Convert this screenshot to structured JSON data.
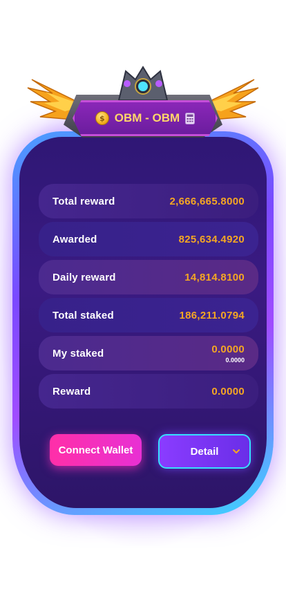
{
  "header": {
    "title": "OBM - OBM",
    "icons": [
      "coin-icon",
      "calculator-icon",
      "gem-crest-icon",
      "wing-left-icon",
      "wing-right-icon"
    ]
  },
  "stats": [
    {
      "label": "Total reward",
      "value": "2,666,665.8000"
    },
    {
      "label": "Awarded",
      "value": "825,634.4920"
    },
    {
      "label": "Daily reward",
      "value": "14,814.8100"
    },
    {
      "label": "Total staked",
      "value": "186,211.0794"
    },
    {
      "label": "My staked",
      "value": "0.0000",
      "sub_value": "0.0000"
    },
    {
      "label": "Reward",
      "value": "0.0000"
    }
  ],
  "actions": {
    "connect_label": "Connect Wallet",
    "detail_label": "Detail"
  },
  "colors": {
    "value": "#f5a623",
    "accent_pink": "#ff2fa8",
    "accent_purple": "#8a3cff",
    "border_cyan": "#36e0ff"
  }
}
